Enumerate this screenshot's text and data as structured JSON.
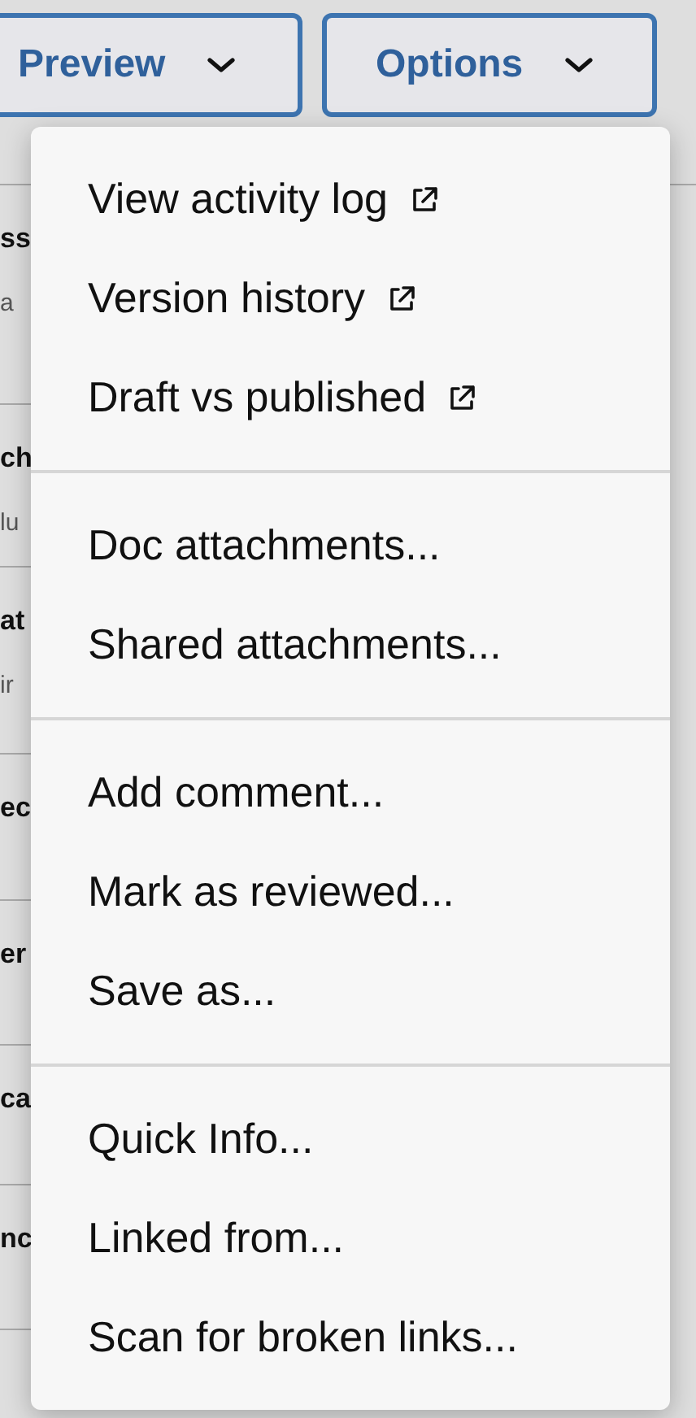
{
  "toolbar": [
    {
      "label": "Preview"
    },
    {
      "label": "Options"
    }
  ],
  "background_rows": [
    {
      "title": "ss",
      "subtitle": "a"
    },
    {
      "title": "ch",
      "subtitle": "lu"
    },
    {
      "title": "at",
      "subtitle": "ir"
    },
    {
      "title": "ec"
    },
    {
      "title": "er"
    },
    {
      "title": "ca"
    },
    {
      "title": "nc"
    }
  ],
  "menu": {
    "sections": [
      [
        {
          "label": "View activity log",
          "external": true
        },
        {
          "label": "Version history",
          "external": true
        },
        {
          "label": "Draft vs published",
          "external": true
        }
      ],
      [
        {
          "label": "Doc attachments...",
          "external": false
        },
        {
          "label": "Shared attachments...",
          "external": false
        }
      ],
      [
        {
          "label": "Add comment...",
          "external": false
        },
        {
          "label": "Mark as reviewed...",
          "external": false
        },
        {
          "label": "Save as...",
          "external": false
        }
      ],
      [
        {
          "label": "Quick Info...",
          "external": false
        },
        {
          "label": "Linked from...",
          "external": false
        },
        {
          "label": "Scan for broken links...",
          "external": false
        }
      ]
    ]
  }
}
